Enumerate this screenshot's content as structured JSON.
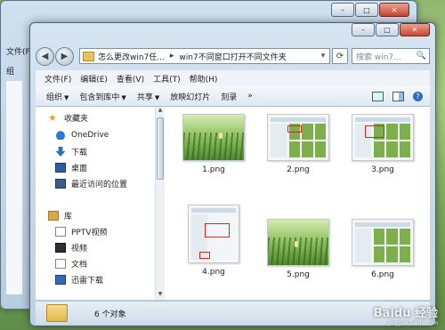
{
  "back_window": {
    "menu": [
      "文件(F)",
      "组"
    ],
    "title_buttons": {
      "minimize": "–",
      "maximize": "□",
      "close": "✕"
    }
  },
  "front_window": {
    "title_buttons": {
      "minimize": "–",
      "maximize": "□",
      "close": "✕"
    },
    "nav": {
      "back": "◀",
      "forward": "▶"
    },
    "address": {
      "parts": [
        "怎么更改win7任...",
        "win7不同窗口打开不同文件夹"
      ],
      "separator": "▸",
      "dropdown": "▾"
    },
    "refresh_icon": "refresh-icon",
    "search": {
      "placeholder": "搜索 win7...",
      "icon": "🔍"
    },
    "menu": [
      "文件(F)",
      "编辑(E)",
      "查看(V)",
      "工具(T)",
      "帮助(H)"
    ],
    "toolbar": {
      "items": [
        "组织",
        "包含到库中",
        "共享",
        "放映幻灯片",
        "刻录",
        "»"
      ],
      "dropdown_arrow": "▼",
      "help_label": "?"
    },
    "sidebar": {
      "favorites_label": "收藏夹",
      "favorites": [
        "OneDrive",
        "下载",
        "桌面",
        "最近访问的位置"
      ],
      "library_label": "库",
      "libraries": [
        "PPTV视频",
        "视频",
        "文档",
        "迅雷下载"
      ],
      "scroll_up": "▲",
      "scroll_down": "▼"
    },
    "files": [
      {
        "name": "1.png",
        "kind": "grass"
      },
      {
        "name": "2.png",
        "kind": "shot"
      },
      {
        "name": "3.png",
        "kind": "shot"
      },
      {
        "name": "4.png",
        "kind": "shot"
      },
      {
        "name": "5.png",
        "kind": "grass"
      },
      {
        "name": "6.png",
        "kind": "shot"
      }
    ],
    "status": {
      "count_text": "6 个对象"
    }
  },
  "watermark": {
    "text": "Baidu 经验",
    "sub": "jingyan.baidu.com"
  }
}
